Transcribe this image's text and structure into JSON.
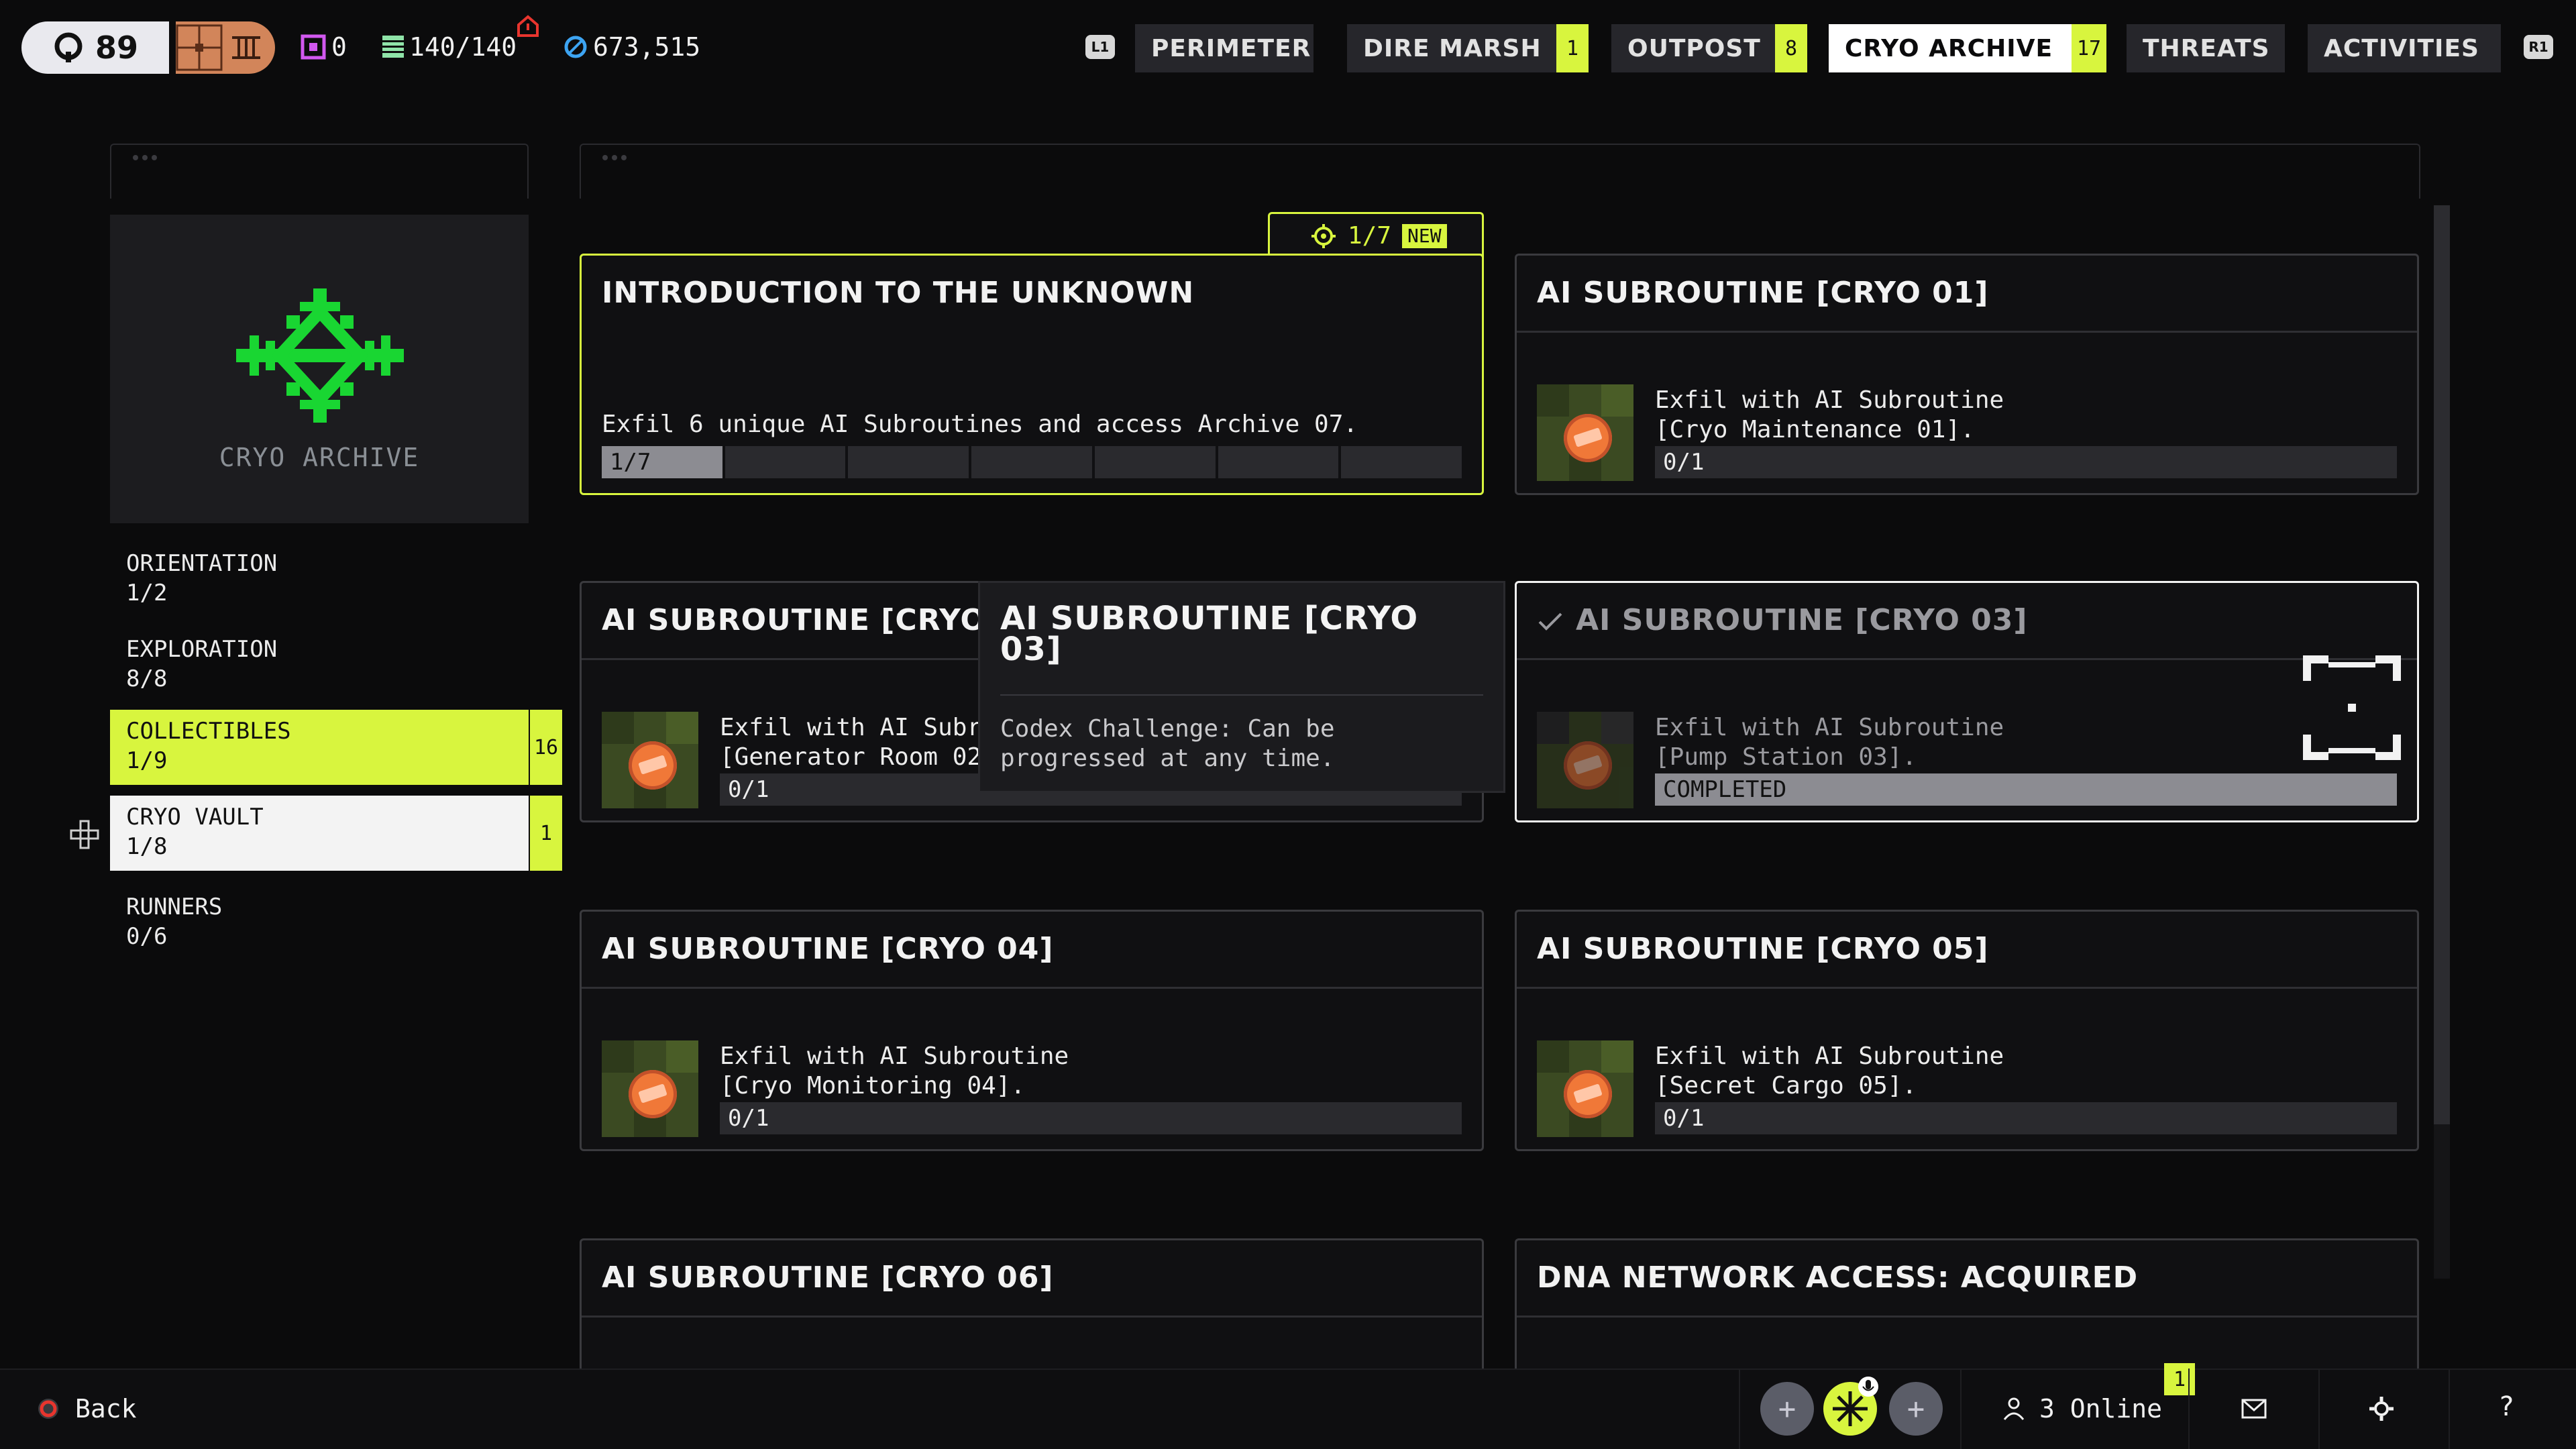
{
  "topbar": {
    "level": "89",
    "currency_a": "0",
    "capacity": "140/140",
    "credits": "673,515",
    "tabs": [
      {
        "label": "PERIMETER",
        "badge": ""
      },
      {
        "label": "DIRE MARSH",
        "badge": "1"
      },
      {
        "label": "OUTPOST",
        "badge": "8"
      },
      {
        "label": "CRYO ARCHIVE",
        "badge": "17",
        "active": true
      },
      {
        "label": "THREATS",
        "badge": ""
      },
      {
        "label": "ACTIVITIES",
        "badge": ""
      }
    ],
    "left_bumper": "L1",
    "right_bumper": "R1"
  },
  "sidebar": {
    "zone_name": "CRYO ARCHIVE",
    "categories": [
      {
        "name": "ORIENTATION",
        "count": "1/2",
        "badge": ""
      },
      {
        "name": "EXPLORATION",
        "count": "8/8",
        "badge": ""
      },
      {
        "name": "COLLECTIBLES",
        "count": "1/9",
        "badge": "16"
      },
      {
        "name": "CRYO VAULT",
        "count": "1/8",
        "badge": "1"
      },
      {
        "name": "RUNNERS",
        "count": "0/6",
        "badge": ""
      }
    ]
  },
  "cards": [
    {
      "title": "INTRODUCTION TO THE UNKNOWN",
      "desc": "Exfil 6 unique AI Subroutines and access Archive 07.",
      "progress": "1/7",
      "progress_fraction": 0.142857,
      "progress_segments": 7,
      "tab_progress": "1/7",
      "tab_badge": "NEW"
    },
    {
      "title": "AI SUBROUTINE [CRYO 01]",
      "desc": "Exfil with AI Subroutine\n[Cryo Maintenance 01].",
      "progress": "0/1"
    },
    {
      "title": "AI SUBROUTINE [CRYO 02]",
      "desc": "Exfil with AI Subroutine\n[Generator Room 02].",
      "progress": "0/1"
    },
    {
      "title": "AI SUBROUTINE [CRYO 03]",
      "desc": "Exfil with AI Subroutine\n[Pump Station 03].",
      "progress": "COMPLETED"
    },
    {
      "title": "AI SUBROUTINE [CRYO 04]",
      "desc": "Exfil with AI Subroutine\n[Cryo Monitoring 04].",
      "progress": "0/1"
    },
    {
      "title": "AI SUBROUTINE [CRYO 05]",
      "desc": "Exfil with AI Subroutine\n[Secret Cargo 05].",
      "progress": "0/1"
    },
    {
      "title": "AI SUBROUTINE [CRYO 06]"
    },
    {
      "title": "DNA NETWORK ACCESS: ACQUIRED"
    }
  ],
  "tooltip": {
    "title": "AI SUBROUTINE [CRYO\n03]",
    "body": "Codex Challenge: Can be\nprogressed at any time."
  },
  "bottombar": {
    "back_label": "Back",
    "online_count": "3 Online",
    "online_badge": "1"
  },
  "colors": {
    "accent": "#d8f53e",
    "background": "#0b0b0c",
    "emblem": "#19d632"
  },
  "icons": [
    "crosshair-icon",
    "inventory-icon",
    "data-cube-icon",
    "ledger-icon",
    "credits-icon",
    "alert-home-icon",
    "mail-icon",
    "gear-icon",
    "help-icon",
    "friends-icon",
    "back-circle-icon",
    "dpad-icon",
    "checkmark-icon",
    "target-reticle-icon"
  ]
}
